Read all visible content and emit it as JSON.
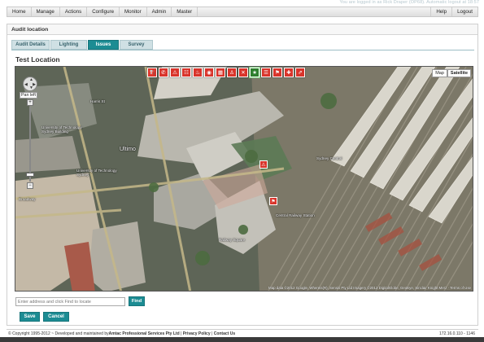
{
  "header": {
    "user_info": "You are logged in as Rick Draper (OP68). Automatic logout at 18:57"
  },
  "nav": {
    "items": [
      "Home",
      "Manage",
      "Actions",
      "Configure",
      "Monitor",
      "Admin",
      "Master"
    ],
    "right_items": [
      "Help",
      "Logout"
    ]
  },
  "panel": {
    "title": "Audit location",
    "tabs": [
      {
        "label": "Audit Details",
        "active": false
      },
      {
        "label": "Lighting",
        "active": false
      },
      {
        "label": "Issues",
        "active": true
      },
      {
        "label": "Survey",
        "active": false
      }
    ],
    "location_title": "Test Location"
  },
  "map": {
    "issue_icons": [
      {
        "name": "fire-extinguisher-icon",
        "glyph": "⛽",
        "selected": false
      },
      {
        "name": "alarm-icon",
        "glyph": "✆",
        "selected": false
      },
      {
        "name": "warning-icon",
        "glyph": "⚠",
        "selected": false
      },
      {
        "name": "ladder-icon",
        "glyph": "☷",
        "selected": false
      },
      {
        "name": "hose-icon",
        "glyph": "♨",
        "selected": false
      },
      {
        "name": "smoke-detector-icon",
        "glyph": "◉",
        "selected": false
      },
      {
        "name": "blanket-icon",
        "glyph": "▦",
        "selected": false
      },
      {
        "name": "hydrant-icon",
        "glyph": "♙",
        "selected": false
      },
      {
        "name": "tools-icon",
        "glyph": "✕",
        "selected": false
      },
      {
        "name": "star-icon",
        "glyph": "★",
        "selected": true
      },
      {
        "name": "stair-icon",
        "glyph": "☰",
        "selected": false
      },
      {
        "name": "flag-icon",
        "glyph": "⚑",
        "selected": false
      },
      {
        "name": "sprinkler-icon",
        "glyph": "✚",
        "selected": false
      },
      {
        "name": "exit-icon",
        "glyph": "⇗",
        "selected": false
      }
    ],
    "map_types": [
      "Map",
      "Satellite"
    ],
    "active_map_type": "Satellite",
    "pan_label": "Pan left",
    "labels": [
      "University of Technology Sydney Building",
      "Ultimo",
      "University of Technology Sydney",
      "Broadway",
      "Central Railway Station",
      "Harris St",
      "Sydney Central",
      "Railway Square"
    ],
    "credit": "Map data ©2012 Google, Whereis(R), Sensis Pty Ltd Imagery ©2012 DigitalGlobe, GeoEye, Sinclair Knight Merz · Terms of Use"
  },
  "search": {
    "placeholder": "Enter address and click Find to locate",
    "find_label": "Find"
  },
  "actions": {
    "save_label": "Save",
    "cancel_label": "Cancel"
  },
  "footer": {
    "copyright": "© Copyright 1995-2012 ~ Developed and maintained by ",
    "company": "Amtac Professional Services Pty Ltd",
    "privacy": "Privacy Policy",
    "contact": "Contact Us",
    "server": "172.16.0.110 - 1146"
  }
}
